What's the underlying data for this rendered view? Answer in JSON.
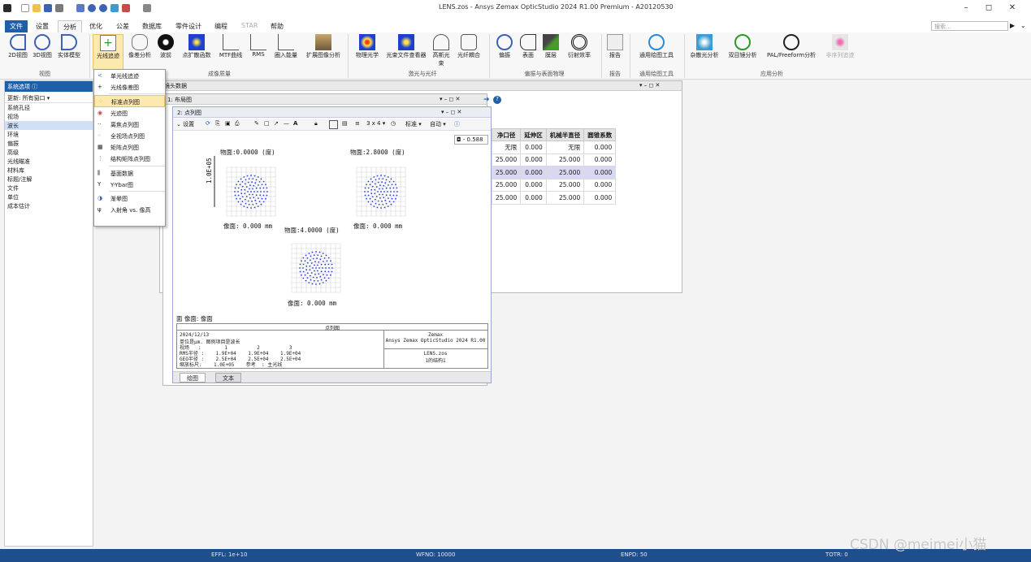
{
  "window": {
    "title": "LENS.zos - Ansys Zemax OpticStudio 2024 R1.00   Premium - A20120530",
    "minimize": "–",
    "maximize": "◻",
    "close": "✕"
  },
  "menubar": {
    "tabs": [
      "文件",
      "设置",
      "分析",
      "优化",
      "公差",
      "数据库",
      "零件设计",
      "编程",
      "STAR",
      "帮助"
    ],
    "search_placeholder": "搜索..."
  },
  "ribbon": {
    "buttons": [
      {
        "label": "2D视图",
        "icon": "layout-2d-icon"
      },
      {
        "label": "3D视图",
        "icon": "layout-3d-icon"
      },
      {
        "label": "实体模型",
        "icon": "shaded-model-icon"
      },
      {
        "label": "光线追迹",
        "icon": "ray-trace-icon"
      },
      {
        "label": "像差分析",
        "icon": "aberration-icon"
      },
      {
        "label": "波前",
        "icon": "wavefront-icon"
      },
      {
        "label": "点扩散函数",
        "icon": "psf-icon"
      },
      {
        "label": "MTF曲线",
        "icon": "mtf-icon"
      },
      {
        "label": "RMS",
        "icon": "rms-icon"
      },
      {
        "label": "圈入能量",
        "icon": "encircled-energy-icon"
      },
      {
        "label": "扩展图像分析",
        "icon": "image-analysis-icon"
      },
      {
        "label": "物理光学",
        "icon": "physical-optics-icon"
      },
      {
        "label": "光束文件查看器",
        "icon": "beam-file-icon"
      },
      {
        "label": "高斯光束",
        "icon": "gaussian-beam-icon"
      },
      {
        "label": "光纤耦合",
        "icon": "fiber-coupling-icon"
      },
      {
        "label": "偏振",
        "icon": "polarization-icon"
      },
      {
        "label": "表面",
        "icon": "surface-icon"
      },
      {
        "label": "膜层",
        "icon": "coating-icon"
      },
      {
        "label": "衍射效率",
        "icon": "diffraction-icon"
      },
      {
        "label": "报告",
        "icon": "report-icon"
      },
      {
        "label": "通用绘图工具",
        "icon": "universal-plot-icon"
      },
      {
        "label": "杂散光分析",
        "icon": "stray-light-icon"
      },
      {
        "label": "双目镜分析",
        "icon": "binocular-icon"
      },
      {
        "label": "PAL/Freeform分析",
        "icon": "freeform-icon"
      },
      {
        "label": "非序列追迹",
        "icon": "nonsequential-icon"
      }
    ],
    "groups": [
      "视图",
      "成像质量",
      "激光与光纤",
      "偏振与表面物理",
      "报告",
      "通用绘图工具",
      "应用分析"
    ]
  },
  "sidebar": {
    "title": "系统选项 ⓘ",
    "update": "更新: 所有窗口 ▾",
    "items": [
      "系统孔径",
      "视场",
      "波长",
      "环境",
      "偏振",
      "高级",
      "光线瞄准",
      "材料库",
      "标题/注解",
      "文件",
      "单位",
      "成本估计"
    ]
  },
  "dropdown": {
    "items": [
      "单光线追迹",
      "光线像差图",
      "标准点列图",
      "光迹图",
      "离焦点列图",
      "全视场点列图",
      "矩阵点列图",
      "结构矩阵点列图",
      "基面数据",
      "Y-Ybar图",
      "渐晕图",
      "入射角 vs. 像高"
    ]
  },
  "lens_window": {
    "title": "镜头数据",
    "controls": "▾ – ◻ ✕",
    "table": {
      "headers": [
        "净口径",
        "延伸区",
        "机械半直径",
        "圆锥系数"
      ],
      "rows": [
        [
          "无限",
          "0.000",
          "无限",
          "0.000"
        ],
        [
          "25.000",
          "0.000",
          "25.000",
          "0.000"
        ],
        [
          "25.000",
          "0.000",
          "25.000",
          "0.000"
        ],
        [
          "25.000",
          "0.000",
          "25.000",
          "0.000"
        ],
        [
          "25.000",
          "0.000",
          "25.000",
          "0.000"
        ]
      ]
    }
  },
  "layout_window": {
    "title": "1: 布局图",
    "controls": "▾ – ◻ ✕"
  },
  "spot_window": {
    "title": "2: 点列图",
    "controls": "▾ – ◻ ✕",
    "toolbar": {
      "settings": "设置",
      "grid": "3 x 4 ▾",
      "standard": "标准 ▾",
      "auto": "自动 ▾"
    },
    "scale_value": "0.588",
    "fields": [
      {
        "obj": "物面:0.0000 (度)",
        "img": "像面: 0.000 mm"
      },
      {
        "obj": "物面:2.8000 (度)",
        "img": "像面: 0.000 mm"
      },
      {
        "obj": "物面:4.0000 (度)",
        "img": "像面: 0.000 mm"
      }
    ],
    "scale_bar": "1.0E+05",
    "surface_label": "面 像面: 像面",
    "info": {
      "title": "点列图",
      "date": "2024/12/13",
      "units": "单位是µm. 图例项目是波长",
      "field_row": "视场   :        1          2          3",
      "rms_row": "RMS半径 :    1.9E+04    1.9E+04    1.9E+04",
      "geo_row": "GEO半径 :    2.5E+04    2.5E+04    2.5E+04",
      "scale_row": "缩放标尺:    1.0E+05    参考  : 主光线",
      "brand": "Zemax",
      "product": "Ansys Zemax OpticStudio 2024 R1.00",
      "file": "LENS.zos",
      "config": "1的结构1"
    },
    "bottom_tabs": [
      "绘图",
      "文本"
    ]
  },
  "status": {
    "effl": "EFFL: 1e+10",
    "wfno": "WFNO: 10000",
    "enpd": "ENPD: 50",
    "totr": "TOTR: 0"
  },
  "watermark": "CSDN @meimei小猫"
}
